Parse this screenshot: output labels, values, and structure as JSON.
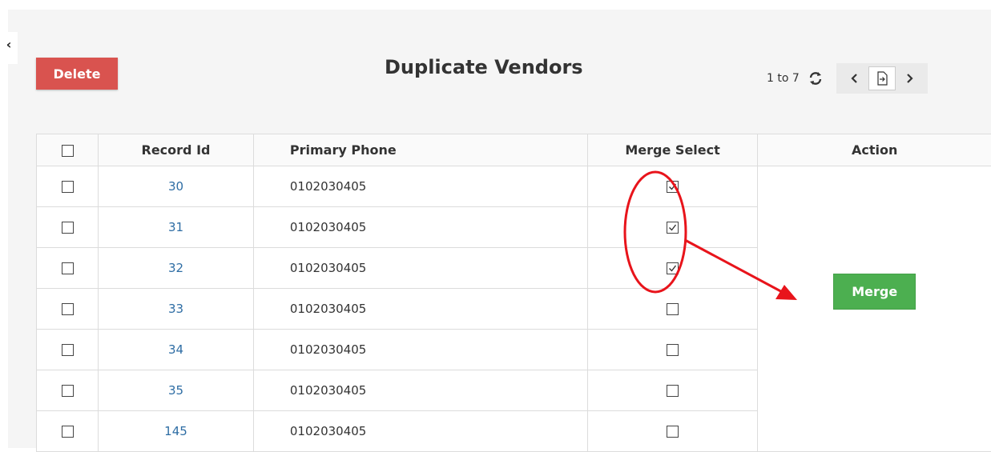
{
  "toolbar": {
    "delete_label": "Delete",
    "collapse_glyph": "‹"
  },
  "page": {
    "title": "Duplicate Vendors"
  },
  "pager": {
    "range": "1 to 7",
    "icons": [
      "refresh-icon",
      "chevron-left-icon",
      "page-export-icon",
      "chevron-right-icon"
    ]
  },
  "table": {
    "columns": [
      "",
      "Record Id",
      "Primary Phone",
      "Merge Select",
      "Action"
    ],
    "rows": [
      {
        "id": "30",
        "phone": "0102030405",
        "merge_selected": true
      },
      {
        "id": "31",
        "phone": "0102030405",
        "merge_selected": true
      },
      {
        "id": "32",
        "phone": "0102030405",
        "merge_selected": true
      },
      {
        "id": "33",
        "phone": "0102030405",
        "merge_selected": false
      },
      {
        "id": "34",
        "phone": "0102030405",
        "merge_selected": false
      },
      {
        "id": "35",
        "phone": "0102030405",
        "merge_selected": false
      },
      {
        "id": "145",
        "phone": "0102030405",
        "merge_selected": false
      }
    ]
  },
  "action": {
    "merge_label": "Merge"
  },
  "colors": {
    "delete": "#d9534f",
    "merge": "#4caf50",
    "link": "#2e6da4",
    "annotation": "#e8141b"
  }
}
